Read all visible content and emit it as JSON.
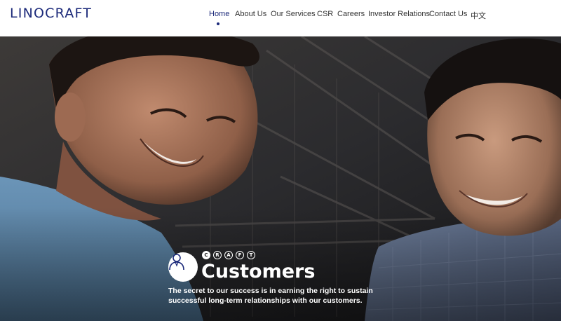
{
  "header": {
    "logo": "LINOCRAFT",
    "nav": [
      {
        "label": "Home",
        "active": true
      },
      {
        "label": "About Us"
      },
      {
        "label": "Our Services"
      },
      {
        "label": "CSR"
      },
      {
        "label": "Careers"
      },
      {
        "label": "Investor Relations"
      },
      {
        "label": "Contact Us"
      },
      {
        "label": "中文"
      }
    ]
  },
  "hero": {
    "craft_letters": [
      "C",
      "R",
      "A",
      "F",
      "T"
    ],
    "active_letter": "C",
    "title": "Customers",
    "text": "The secret to our success is in earning the right to sustain successful long-term relationships with our customers.",
    "icon": "customer-person-icon"
  },
  "colors": {
    "brand": "#1c2a7a",
    "nav_text": "#333333",
    "overlay_text": "#ffffff"
  }
}
